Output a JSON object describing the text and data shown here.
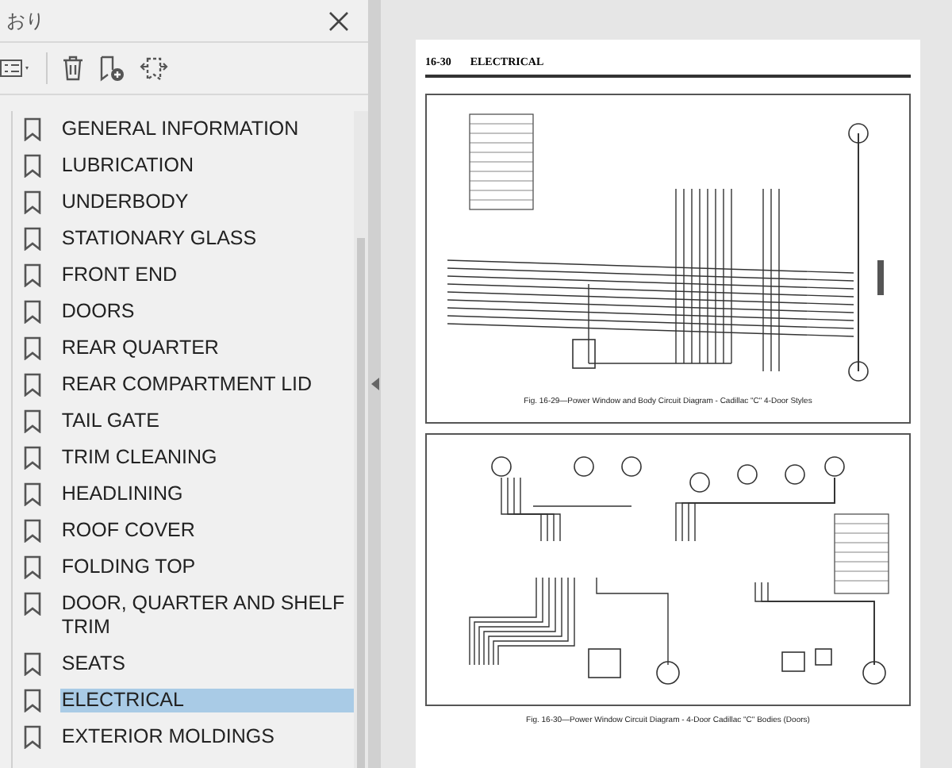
{
  "panel": {
    "title": "おり"
  },
  "bookmarks": [
    {
      "label": "GENERAL INFORMATION",
      "selected": false
    },
    {
      "label": "LUBRICATION",
      "selected": false
    },
    {
      "label": "UNDERBODY",
      "selected": false
    },
    {
      "label": "STATIONARY GLASS",
      "selected": false
    },
    {
      "label": "FRONT END",
      "selected": false
    },
    {
      "label": "DOORS",
      "selected": false
    },
    {
      "label": "REAR QUARTER",
      "selected": false
    },
    {
      "label": "REAR COMPARTMENT LID",
      "selected": false
    },
    {
      "label": "TAIL GATE",
      "selected": false
    },
    {
      "label": "TRIM CLEANING",
      "selected": false
    },
    {
      "label": "HEADLINING",
      "selected": false
    },
    {
      "label": "ROOF COVER",
      "selected": false
    },
    {
      "label": "FOLDING TOP",
      "selected": false
    },
    {
      "label": "DOOR, QUARTER AND SHELF TRIM",
      "selected": false
    },
    {
      "label": "SEATS",
      "selected": false
    },
    {
      "label": "ELECTRICAL",
      "selected": true
    },
    {
      "label": "EXTERIOR MOLDINGS",
      "selected": false
    }
  ],
  "page": {
    "page_number": "16-30",
    "section": "ELECTRICAL",
    "figures": [
      {
        "caption": "Fig. 16-29—Power Window and Body Circuit Diagram - Cadillac \"C\" 4-Door Styles"
      },
      {
        "caption": "Fig. 16-30—Power Window Circuit Diagram - 4-Door Cadillac \"C\" Bodies (Doors)"
      }
    ]
  }
}
